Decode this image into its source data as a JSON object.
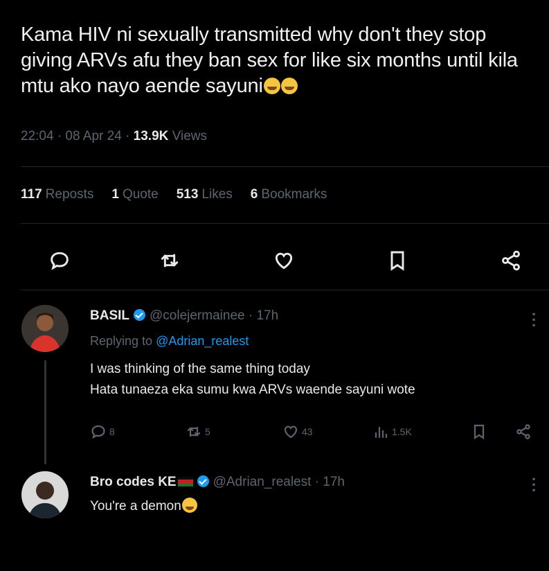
{
  "tweet": {
    "text": "Kama HIV ni sexually transmitted why don't they stop giving ARVs afu they ban sex for like six months until kila mtu ako nayo aende sayuni",
    "time": "22:04 · 08 Apr 24 · ",
    "views_count": "13.9K",
    "views_label": " Views"
  },
  "stats": {
    "reposts_count": "117",
    "reposts_label": "Reposts",
    "quotes_count": "1",
    "quotes_label": "Quote",
    "likes_count": "513",
    "likes_label": "Likes",
    "bookmarks_count": "6",
    "bookmarks_label": "Bookmarks"
  },
  "icons": {
    "reply": "reply-icon",
    "repost": "repost-icon",
    "like": "heart-icon",
    "bookmark": "bookmark-icon",
    "share": "share-icon",
    "verified": "verified-badge-icon",
    "views": "views-bar-icon",
    "more": "more-icon"
  },
  "replies": [
    {
      "name": "BASIL",
      "handle": "@colejermainee · 17h",
      "replying_prefix": "Replying to ",
      "replying_to": "@Adrian_realest",
      "line1": "I was thinking of the same thing today",
      "line2": "Hata tunaeza eka sumu kwa ARVs waende sayuni wote",
      "reply_count": "8",
      "repost_count": "5",
      "like_count": "43",
      "view_count": "1.5K"
    },
    {
      "name": "Bro codes KE",
      "handle": "@Adrian_realest · 17h",
      "text": "You're a demon"
    }
  ],
  "colors": {
    "background": "#000000",
    "text": "#e7e9ea",
    "muted": "#5d6570",
    "accent": "#1d9bf0"
  }
}
